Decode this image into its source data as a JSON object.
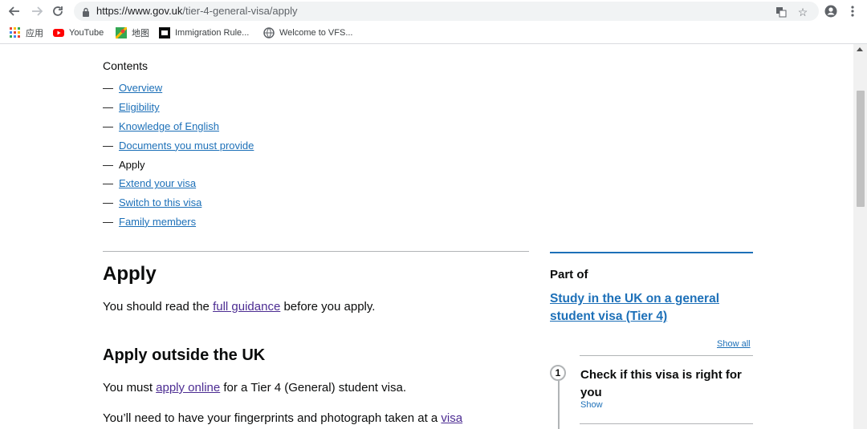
{
  "browser": {
    "url_host": "https://www.gov.uk",
    "url_path": "/tier-4-general-visa/apply",
    "bookmarks": [
      {
        "label": "应用",
        "icon": "apps-grid-icon"
      },
      {
        "label": "YouTube",
        "icon": "youtube-icon"
      },
      {
        "label": "地图",
        "icon": "maps-icon"
      },
      {
        "label": "Immigration Rule...",
        "icon": "immigration-favicon-icon"
      },
      {
        "label": "Welcome to VFS...",
        "icon": "globe-icon"
      }
    ]
  },
  "contents": {
    "title": "Contents",
    "dash": "—",
    "items": [
      {
        "label": "Overview"
      },
      {
        "label": "Eligibility"
      },
      {
        "label": "Knowledge of English"
      },
      {
        "label": "Documents you must provide"
      },
      {
        "label": "Apply"
      },
      {
        "label": "Extend your visa"
      },
      {
        "label": "Switch to this visa"
      },
      {
        "label": "Family members"
      }
    ]
  },
  "main": {
    "heading": "Apply",
    "p1_before": "You should read the ",
    "p1_link": "full guidance",
    "p1_after": " before you apply.",
    "heading2": "Apply outside the UK",
    "p2_before": "You must ",
    "p2_link": "apply online",
    "p2_after": " for a Tier 4 (General) student visa.",
    "p3_before": "You’ll need to have your fingerprints and photograph taken at a ",
    "p3_link": "visa"
  },
  "sidebar": {
    "part_of": "Part of",
    "series_link": "Study in the UK on a general student visa (Tier 4)",
    "show_all": "Show all",
    "step_number": "1",
    "step_title": "Check if this visa is right for you",
    "step_show": "Show"
  },
  "colors": {
    "link": "#1d70b8",
    "visited": "#4c2c92",
    "text": "#0b0c0c"
  }
}
